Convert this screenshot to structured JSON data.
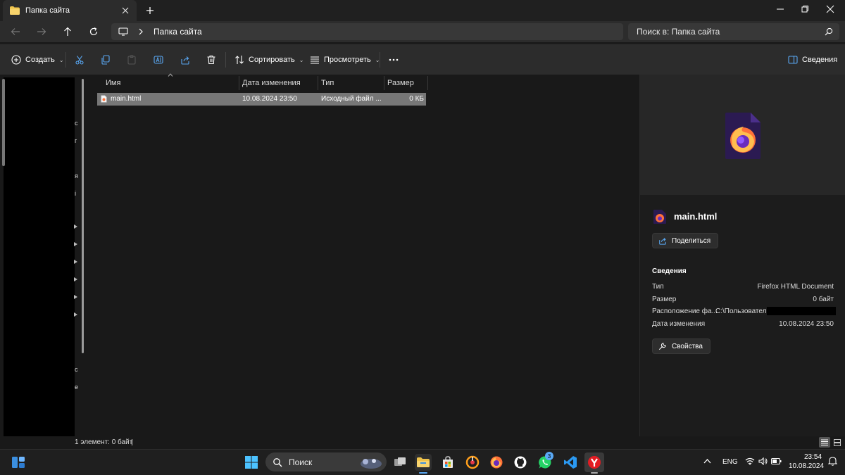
{
  "window": {
    "tab_title": "Папка сайта",
    "path_crumb": "Папка сайта",
    "search_placeholder": "Поиск в: Папка сайта"
  },
  "toolbar": {
    "create": "Создать",
    "sort": "Сортировать",
    "view": "Просмотреть",
    "details": "Сведения"
  },
  "nav_pane_glyphs": [
    "с",
    "г",
    "я",
    "і",
    "с",
    "е"
  ],
  "columns": {
    "name": "Имя",
    "date": "Дата изменения",
    "type": "Тип",
    "size": "Размер"
  },
  "files": [
    {
      "name": "main.html",
      "date": "10.08.2024 23:50",
      "type": "Исходный файл ...",
      "size": "0 КБ"
    }
  ],
  "details_pane": {
    "file_name": "main.html",
    "share_label": "Поделиться",
    "section_heading": "Сведения",
    "properties": [
      {
        "label": "Тип",
        "value": "Firefox HTML Document"
      },
      {
        "label": "Размер",
        "value": "0 байт"
      },
      {
        "label": "Расположение фа...",
        "value": "C:\\Пользователи"
      },
      {
        "label": "Дата изменения",
        "value": "10.08.2024 23:50"
      }
    ],
    "properties_button": "Свойства"
  },
  "status": {
    "summary": "1 элемент: 0 байт"
  },
  "taskbar": {
    "search_label": "Поиск",
    "whatsapp_badge": "3",
    "language": "ENG",
    "time": "23:54",
    "date": "10.08.2024"
  },
  "colors": {
    "accent": "#0078d4",
    "folder": "#f0c44c",
    "selection": "#777777",
    "firefox_orange": "#ff7139",
    "firefox_purple": "#6a2bbd"
  }
}
